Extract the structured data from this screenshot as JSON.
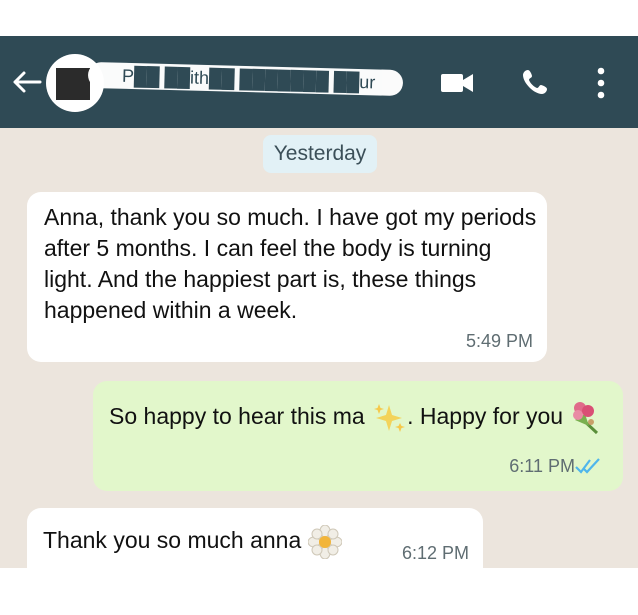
{
  "header": {
    "contact_name": "P██ ██ith██ ███████ ██ur",
    "icons": [
      "back-arrow-icon",
      "avatar",
      "video-call-icon",
      "phone-icon",
      "more-vert-icon"
    ]
  },
  "chat": {
    "date_chip": "Yesterday",
    "messages": [
      {
        "direction": "incoming",
        "text": "Anna, thank you so much. I have got my periods after 5 months. I can feel the body is turning light. And the happiest part is, these things happened within a week.",
        "time": "5:49 PM"
      },
      {
        "direction": "outgoing",
        "text_part1": "So happy to hear this ma ",
        "text_part2": ". Happy for you ",
        "emoji1": "sparkles-emoji",
        "emoji2": "bouquet-emoji",
        "time": "6:11 PM",
        "status": "read-double-check"
      },
      {
        "direction": "incoming",
        "text": "Thank you so much anna ",
        "emoji": "blossom-emoji",
        "time": "6:12 PM"
      }
    ]
  },
  "colors": {
    "header_bg": "#2f4a55",
    "chat_bg": "#ece5dd",
    "incoming_bubble": "#ffffff",
    "outgoing_bubble": "#e2f7cb",
    "read_check": "#4fb6ec"
  }
}
